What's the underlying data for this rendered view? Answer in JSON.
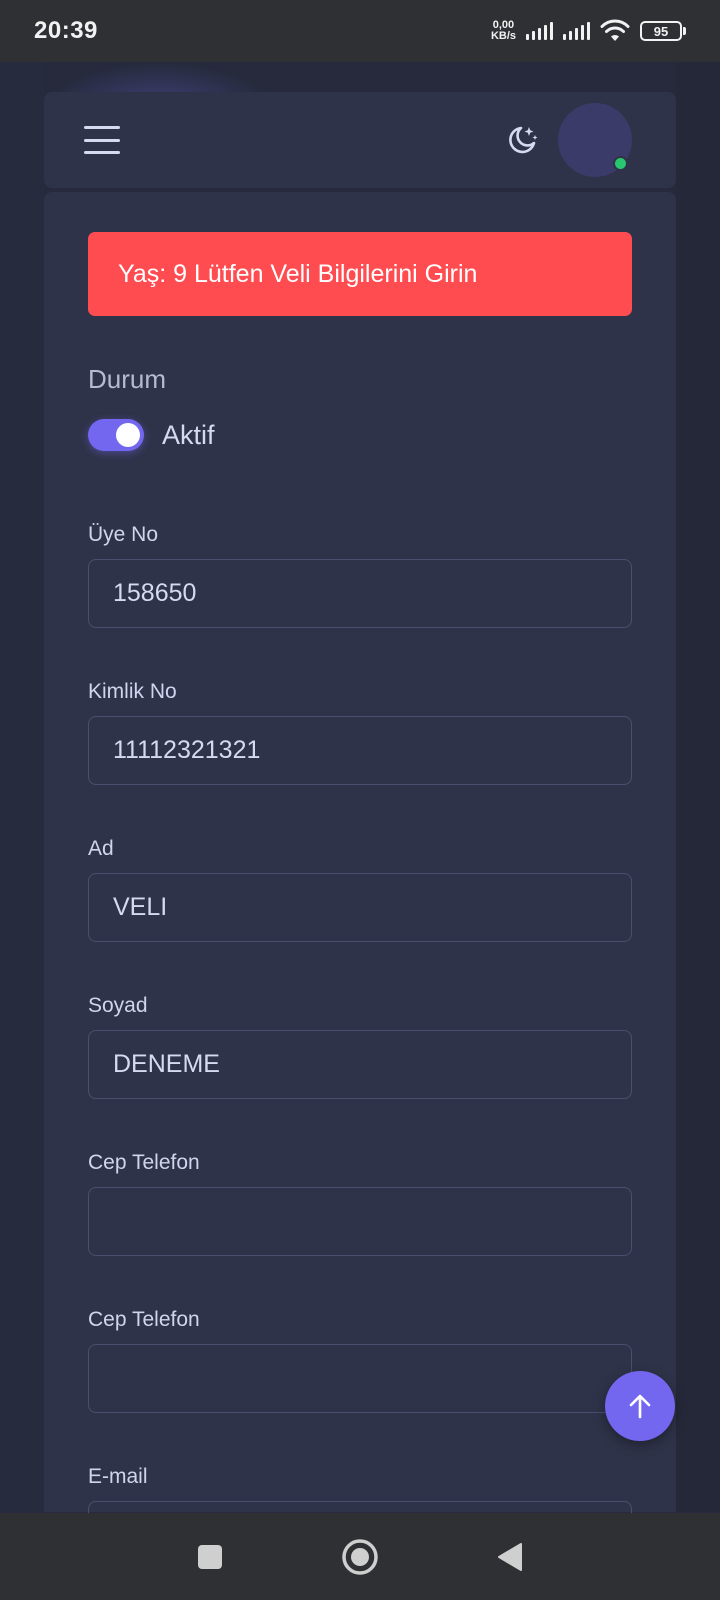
{
  "status_bar": {
    "time": "20:39",
    "net_speed_value": "0,00",
    "net_speed_unit": "KB/s",
    "battery": "95"
  },
  "header": {
    "menu_icon": "hamburger-menu-icon",
    "theme_icon": "moon-stars-icon",
    "avatar_status_color": "#28c76f"
  },
  "alert": {
    "text": "Yaş: 9 Lütfen Veli Bilgilerini Girin",
    "color": "#ff4c51"
  },
  "status": {
    "label": "Durum",
    "toggle_label": "Aktif",
    "enabled": true,
    "accent": "#7367f0"
  },
  "fields": {
    "uye_no": {
      "label": "Üye No",
      "value": "158650"
    },
    "kimlik_no": {
      "label": "Kimlik No",
      "value": "11112321321"
    },
    "ad": {
      "label": "Ad",
      "value": "VELI"
    },
    "soyad": {
      "label": "Soyad",
      "value": "DENEME"
    },
    "cep_telefon_1": {
      "label": "Cep Telefon",
      "value": ""
    },
    "cep_telefon_2": {
      "label": "Cep Telefon",
      "value": ""
    },
    "email": {
      "label": "E-mail",
      "value": ""
    }
  },
  "fab": {
    "icon": "arrow-up-icon"
  },
  "nav": {
    "recents_icon": "square-icon",
    "home_icon": "circle-home-icon",
    "back_icon": "triangle-back-icon"
  }
}
